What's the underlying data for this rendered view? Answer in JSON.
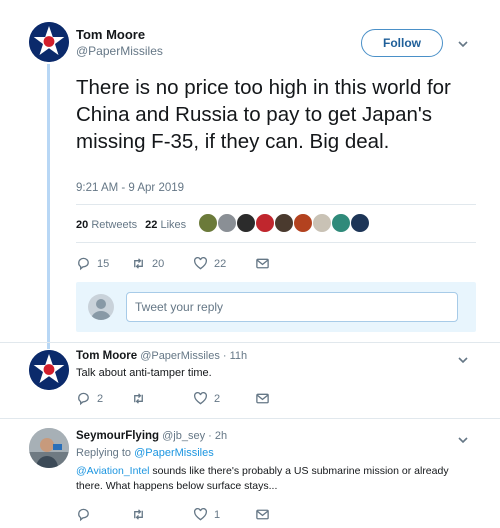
{
  "main_tweet": {
    "display_name": "Tom Moore",
    "handle": "@PaperMissiles",
    "follow_label": "Follow",
    "text": "There is no price too high in this world for China and Russia to pay to get Japan's missing F-35, if they can. Big deal.",
    "timestamp": "9:21 AM - 9 Apr 2019",
    "retweets_count": "20",
    "retweets_label": "Retweets",
    "likes_count": "22",
    "likes_label": "Likes",
    "reply_count": "15",
    "retweet_count": "20",
    "like_count": "22",
    "reply_placeholder": "Tweet your reply"
  },
  "replies": [
    {
      "display_name": "Tom Moore",
      "meta": "@PaperMissiles · 11h",
      "text": "Talk about anti-tamper time.",
      "reply_count": "2",
      "retweet_count": "",
      "like_count": "2"
    },
    {
      "display_name": "SeymourFlying",
      "meta": "@jb_sey · 2h",
      "replying_prefix": "Replying to",
      "replying_to": "@PaperMissiles",
      "mention": "@Aviation_Intel",
      "text": " sounds like there's probably a US submarine mission or already there. What happens below surface stays...",
      "reply_count": "",
      "retweet_count": "",
      "like_count": "1"
    }
  ],
  "colors": {
    "accent": "#1b95e0",
    "roundel_blue": "#0b2a6b",
    "roundel_red": "#d21f2b",
    "thread_line": "#b8d7f5",
    "reply_box_bg": "#e8f5fd"
  },
  "icons": [
    "chevron-down-icon",
    "reply-icon",
    "retweet-icon",
    "like-icon",
    "message-icon",
    "star-roundel-avatar",
    "user-avatar"
  ]
}
